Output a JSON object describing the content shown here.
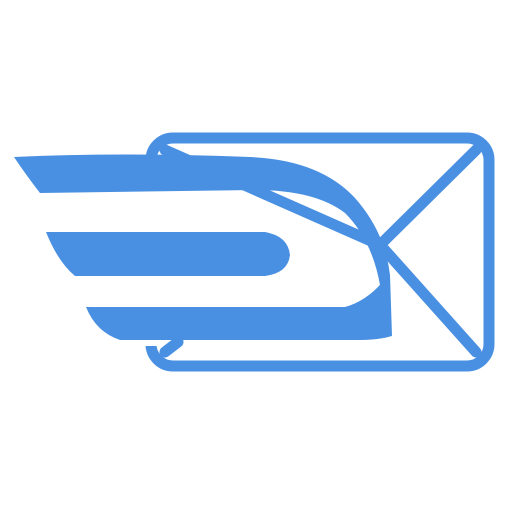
{
  "logo": {
    "icon": "winged-envelope-mail-icon",
    "color": "#4A90E2",
    "background": "#ffffff"
  }
}
